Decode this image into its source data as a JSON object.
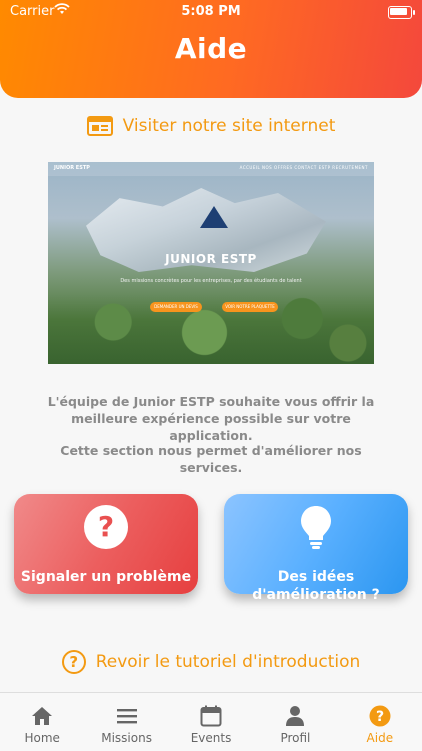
{
  "status_bar": {
    "carrier": "Carrier",
    "time": "5:08 PM"
  },
  "header": {
    "title": "Aide"
  },
  "site_link": {
    "label": "Visiter notre site internet",
    "icon": "website-icon"
  },
  "preview": {
    "brand": "JUNIOR ESTP",
    "logo_text": "JUNIOR ESTP",
    "nav": "ACCUEIL   NOS OFFRES   CONTACT   ESTP   RECRUTEMENT",
    "tagline": "Des missions concrètes pour les entreprises, par des étudiants de talent",
    "button_1": "DEMANDER UN DEVIS",
    "button_2": "VOIR NOTRE PLAQUETTE"
  },
  "description": {
    "line1": "L'équipe de Junior ESTP souhaite vous offrir la meilleure expérience possible sur votre application.",
    "line2": "Cette section nous permet d'améliorer nos services."
  },
  "cards": {
    "report": {
      "label": "Signaler un problème",
      "icon": "question-circle-icon",
      "color": "#ec5f5f"
    },
    "ideas": {
      "label": "Des idées d'amélioration ?",
      "icon": "lightbulb-icon",
      "color": "#4aa8f8"
    }
  },
  "tutorial": {
    "label": "Revoir le tutoriel d'introduction",
    "icon": "question-circle-icon"
  },
  "tabs": [
    {
      "label": "Home",
      "icon": "home-icon"
    },
    {
      "label": "Missions",
      "icon": "menu-icon"
    },
    {
      "label": "Events",
      "icon": "calendar-icon"
    },
    {
      "label": "Profil",
      "icon": "person-icon"
    },
    {
      "label": "Aide",
      "icon": "help-icon",
      "active": true
    }
  ],
  "colors": {
    "accent": "#f39a12",
    "header_start": "#ff8a00",
    "header_end": "#f4483c"
  }
}
